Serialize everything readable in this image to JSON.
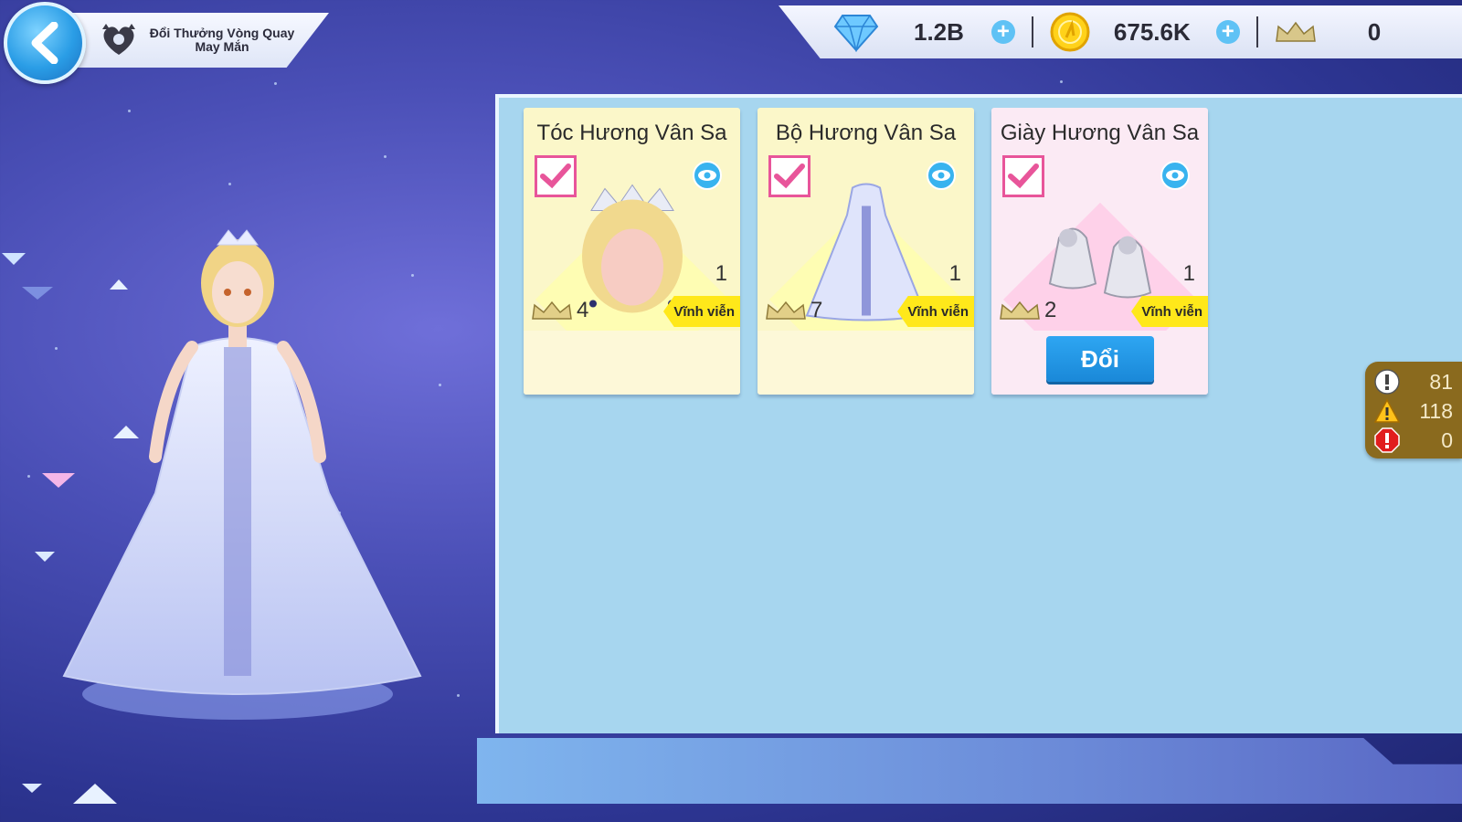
{
  "header": {
    "title_line1": "Đổi Thưởng Vòng Quay",
    "title_line2": "May Mắn"
  },
  "currencies": {
    "diamond": "1.2B",
    "gold": "675.6K",
    "crown": "0"
  },
  "items": [
    {
      "name": "Tóc Hương Vân Sa",
      "quantity": "1",
      "crown_cost": "4",
      "duration": "Vĩnh viễn",
      "checked": true,
      "card_color": "#fbf7c9"
    },
    {
      "name": "Bộ Hương Vân Sa",
      "quantity": "1",
      "crown_cost": "7",
      "duration": "Vĩnh viễn",
      "checked": true,
      "card_color": "#fbf7c9"
    },
    {
      "name": "Giày Hương Vân Sa",
      "quantity": "1",
      "crown_cost": "2",
      "duration": "Vĩnh viễn",
      "checked": true,
      "card_color": "#fbeaf4",
      "button_label": "Đổi"
    }
  ],
  "debug_counter": {
    "info": "81",
    "warning": "118",
    "error": "0"
  },
  "colors": {
    "accent_blue": "#1a88d8",
    "panel_bg": "#a7d6ef",
    "tag_yellow": "#ffe81a",
    "checkbox_pink": "#e8559a"
  }
}
